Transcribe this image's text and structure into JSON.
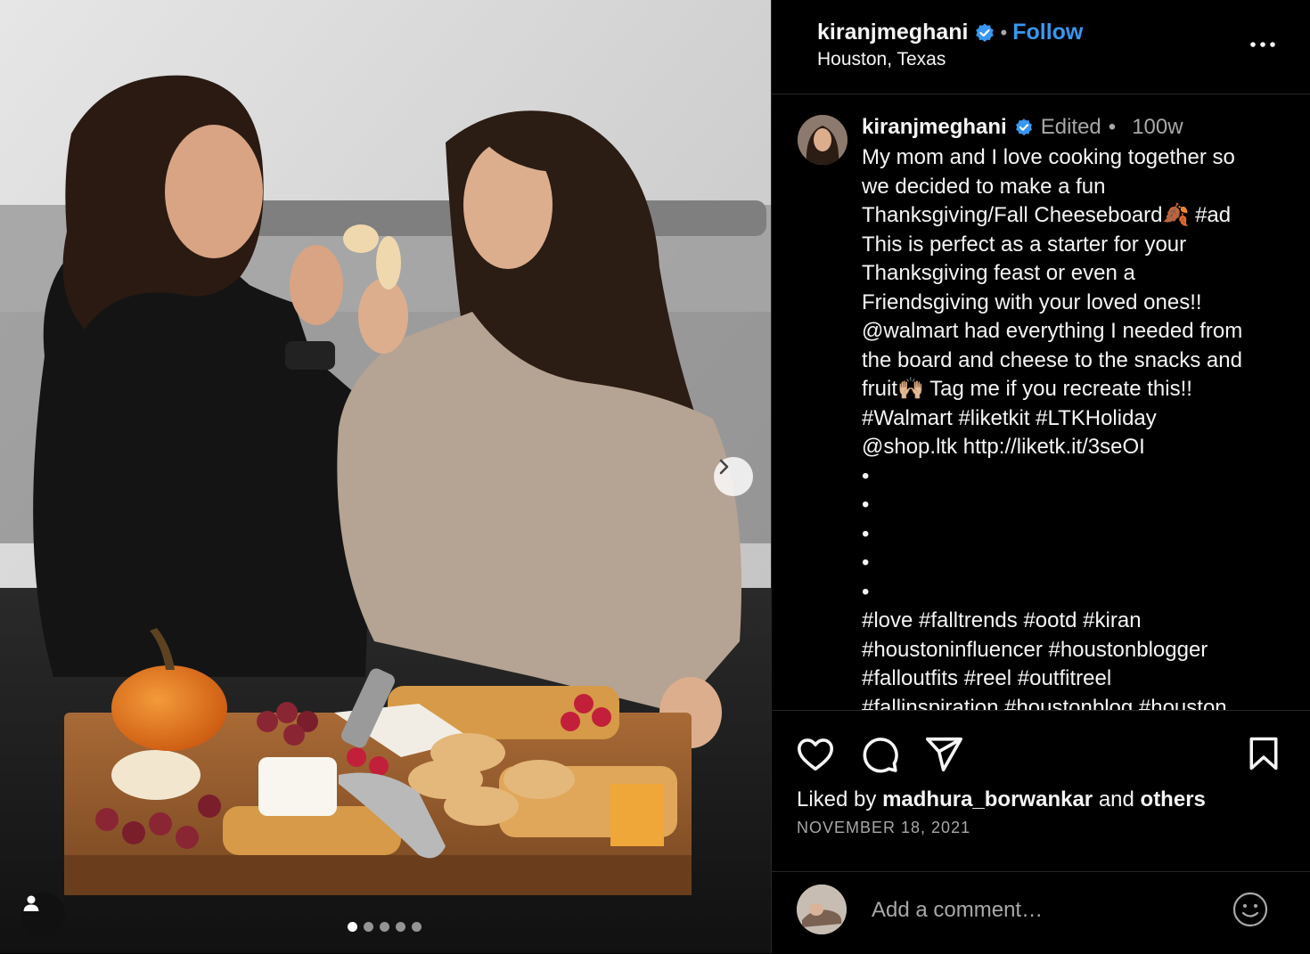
{
  "header": {
    "username": "kiranjmeghani",
    "separator": "•",
    "follow_label": "Follow",
    "location": "Houston, Texas"
  },
  "caption": {
    "username": "kiranjmeghani",
    "edited_label": "Edited",
    "separator": "•",
    "time": "100w",
    "text": "My mom and I love cooking together so\nwe decided to make a fun\nThanksgiving/Fall Cheeseboard🍂 #ad\nThis is perfect as a starter for your\nThanksgiving feast or even a\nFriendsgiving with your loved ones!!\n@walmart had everything I needed from\nthe board and cheese to the snacks and\nfruit🙌🏼 Tag me if you recreate this!!\n#Walmart #liketkit #LTKHoliday\n@shop.ltk http://liketk.it/3seOI\n•\n•\n•\n•\n•\n#love #falltrends #ootd #kiran\n#houstoninfluencer #houstonblogger\n#falloutfits #reel #outfitreel\n#fallinspiration #houstonblog #houston"
  },
  "likes": {
    "prefix": "Liked by",
    "user": "madhura_borwankar",
    "and": "and",
    "others": "others"
  },
  "date": "NOVEMBER 18, 2021",
  "comment": {
    "placeholder": "Add a comment…"
  },
  "carousel": {
    "slide_count": 5,
    "active_index": 0
  },
  "colors": {
    "accent": "#3897f0",
    "verified": "#3897f0",
    "muted": "#a8a8a8"
  },
  "icons": [
    "verified-badge-icon",
    "more-options-icon",
    "chevron-right-icon",
    "user-tag-icon",
    "heart-icon",
    "comment-icon",
    "share-icon",
    "bookmark-icon",
    "emoji-icon"
  ]
}
